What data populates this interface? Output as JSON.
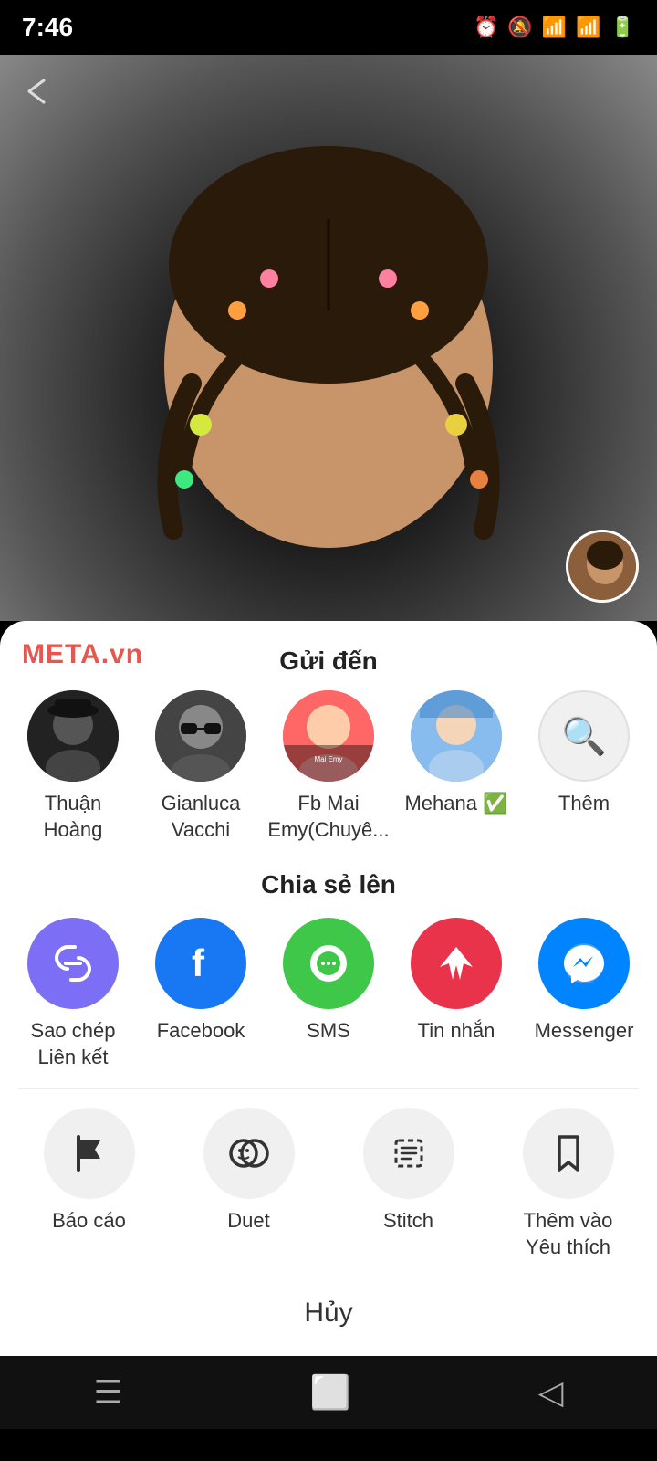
{
  "statusBar": {
    "time": "7:46"
  },
  "backButton": "←",
  "metaLogo": "META.vn",
  "sendSection": {
    "title": "Gửi đến",
    "contacts": [
      {
        "name": "Thuận Hoàng",
        "avatarClass": "avatar-1"
      },
      {
        "name": "Gianluca Vacchi",
        "avatarClass": "avatar-2"
      },
      {
        "name": "Fb Mai Emy(Chuyê...",
        "avatarClass": "avatar-3"
      },
      {
        "name": "Mehana ✅",
        "avatarClass": "avatar-4"
      },
      {
        "name": "Thêm",
        "avatarClass": "search-btn"
      }
    ]
  },
  "shareSection": {
    "title": "Chia sẻ lên",
    "items": [
      {
        "label": "Sao chép Liên kết",
        "iconClass": "icon-copy"
      },
      {
        "label": "Facebook",
        "iconClass": "icon-facebook"
      },
      {
        "label": "SMS",
        "iconClass": "icon-sms"
      },
      {
        "label": "Tin nhắn",
        "iconClass": "icon-tin-nhan"
      },
      {
        "label": "Messenger",
        "iconClass": "icon-messenger"
      }
    ]
  },
  "actionSection": {
    "items": [
      {
        "label": "Báo cáo"
      },
      {
        "label": "Duet"
      },
      {
        "label": "Stitch"
      },
      {
        "label": "Thêm vào Yêu thích"
      }
    ]
  },
  "cancelButton": "Hủy"
}
